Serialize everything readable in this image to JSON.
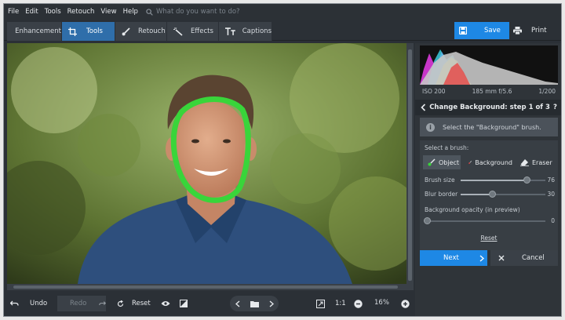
{
  "menu": [
    "File",
    "Edit",
    "Tools",
    "Retouch",
    "View",
    "Help"
  ],
  "search": {
    "placeholder": "What do you want to do?"
  },
  "tabs": [
    {
      "label": "Enhancement",
      "icon": "sliders-icon"
    },
    {
      "label": "Tools",
      "icon": "crop-icon",
      "active": true
    },
    {
      "label": "Retouch",
      "icon": "brush-icon"
    },
    {
      "label": "Effects",
      "icon": "magic-wand-icon"
    },
    {
      "label": "Captions",
      "icon": "text-icon"
    }
  ],
  "save_label": "Save",
  "print_label": "Print",
  "exif": {
    "iso": "ISO 200",
    "lens": "185 mm f/5.6",
    "shutter": "1/200"
  },
  "step": {
    "title": "Change Background: step 1 of 3",
    "help": "?"
  },
  "info": {
    "icon": "i",
    "text": "Select the \"Background\" brush."
  },
  "brush": {
    "title": "Select a brush:",
    "buttons": [
      "Object",
      "Background",
      "Eraser"
    ],
    "active": "Object"
  },
  "sliders": [
    {
      "label": "Brush size",
      "value": "76",
      "level": 0.78
    },
    {
      "label": "Blur border",
      "value": "30",
      "level": 0.37
    },
    {
      "label": "Background opacity (in preview)",
      "value": "0",
      "level": 0.0
    }
  ],
  "reset_link": "Reset",
  "next_label": "Next",
  "cancel_label": "Cancel",
  "bottom": {
    "undo": "Undo",
    "redo": "Redo",
    "reset": "Reset",
    "ratio": "1:1",
    "zoom": "16%"
  },
  "colors": {
    "accent": "#1e88e5",
    "active_tab": "#2f6eaa",
    "selection": "#39d53a"
  }
}
